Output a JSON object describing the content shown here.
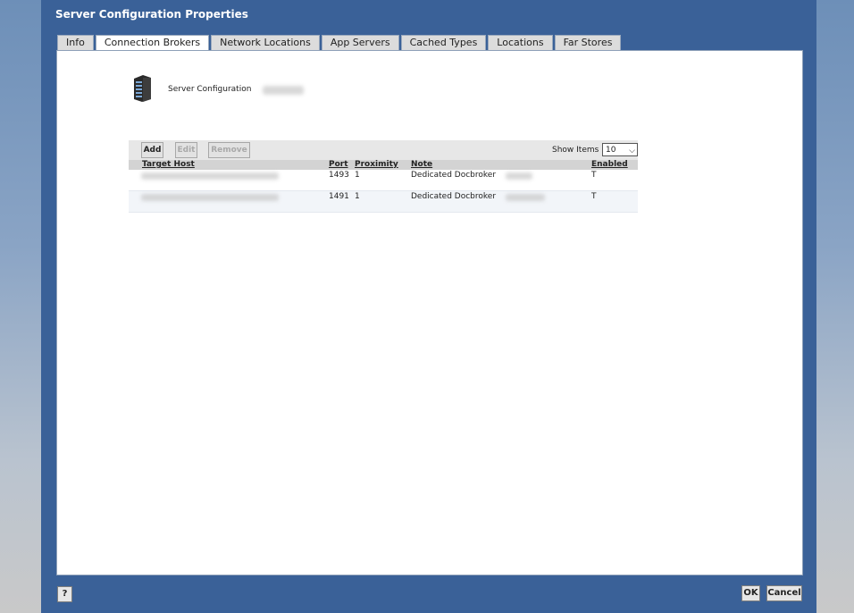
{
  "dialog": {
    "title": "Server Configuration Properties"
  },
  "tabs": [
    {
      "label": "Info",
      "active": false
    },
    {
      "label": "Connection Brokers",
      "active": true
    },
    {
      "label": "Network Locations",
      "active": false
    },
    {
      "label": "App Servers",
      "active": false
    },
    {
      "label": "Cached Types",
      "active": false
    },
    {
      "label": "Locations",
      "active": false
    },
    {
      "label": "Far Stores",
      "active": false
    }
  ],
  "server": {
    "label": "Server Configuration",
    "icon": "server-rack-icon"
  },
  "toolbar": {
    "add_label": "Add",
    "edit_label": "Edit",
    "remove_label": "Remove",
    "show_items_label": "Show Items",
    "show_items_value": "10"
  },
  "table": {
    "columns": {
      "target_host": "Target Host",
      "port": "Port",
      "proximity": "Proximity",
      "note": "Note",
      "enabled": "Enabled"
    },
    "rows": [
      {
        "port": "1493",
        "proximity": "1",
        "note": "Dedicated Docbroker",
        "enabled": "T"
      },
      {
        "port": "1491",
        "proximity": "1",
        "note": "Dedicated Docbroker",
        "enabled": "T"
      }
    ]
  },
  "footer": {
    "help_label": "?",
    "ok_label": "OK",
    "cancel_label": "Cancel"
  },
  "colors": {
    "dialog_bg": "#3a6198",
    "content_bg": "#ffffff",
    "toolbar_bg": "#e7e7e7",
    "header_bg": "#d3d3d3"
  }
}
